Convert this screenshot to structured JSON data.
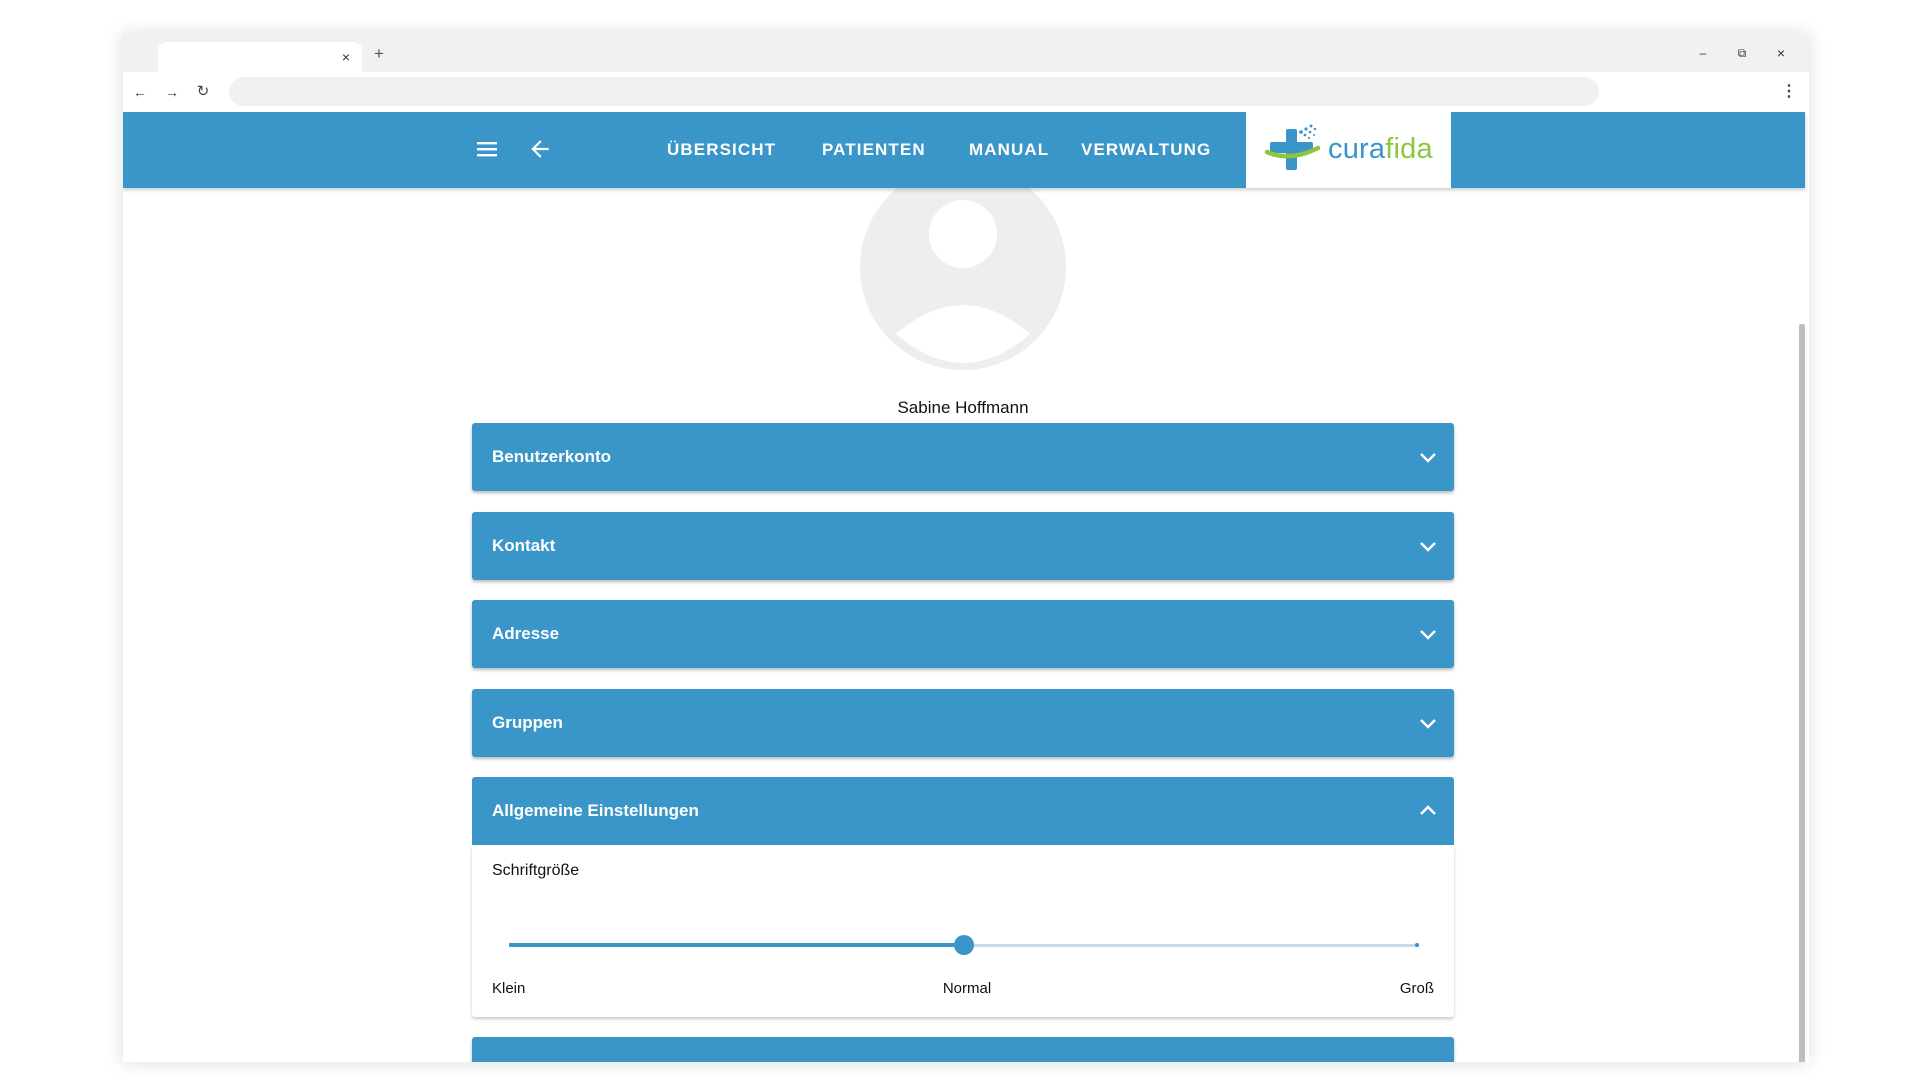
{
  "browser": {
    "tab_close": "×",
    "new_tab": "+",
    "minimize": "–",
    "restore": "⧉",
    "close": "×",
    "back": "←",
    "forward": "→",
    "reload": "↻",
    "menu": "⋮",
    "address": ""
  },
  "appbar": {
    "nav": [
      "ÜBERSICHT",
      "PATIENTEN",
      "MANUAL",
      "VERWALTUNG"
    ],
    "logo_a": "cura",
    "logo_b": "fida",
    "color": "#3a96c9"
  },
  "profile": {
    "name": "Sabine Hoffmann"
  },
  "panels": [
    {
      "title": "Benutzerkonto",
      "expanded": false
    },
    {
      "title": "Kontakt",
      "expanded": false
    },
    {
      "title": "Adresse",
      "expanded": false
    },
    {
      "title": "Gruppen",
      "expanded": false
    },
    {
      "title": "Allgemeine Einstellungen",
      "expanded": true
    }
  ],
  "settings": {
    "font_size_label": "Schriftgröße",
    "slider_value": 0.5,
    "marks": [
      "Klein",
      "Normal",
      "Groß"
    ]
  },
  "icons": {
    "menu": "hamburger-icon",
    "back": "arrow-back-icon",
    "collapsed": "chevron-down-icon",
    "expanded": "chevron-up-icon"
  }
}
